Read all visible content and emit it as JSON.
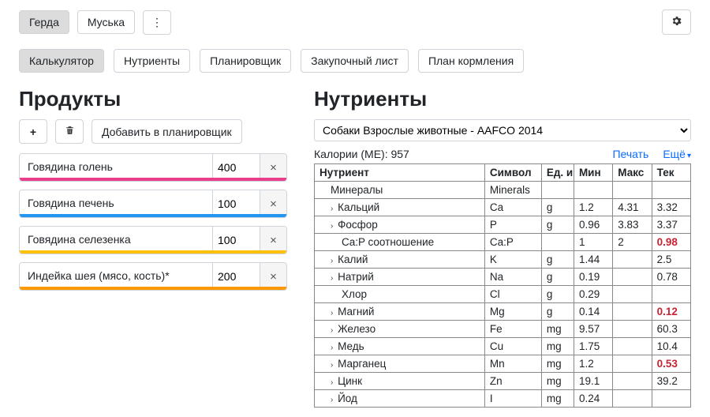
{
  "pets": [
    "Герда",
    "Муська"
  ],
  "activePetIndex": 0,
  "tabs": [
    "Калькулятор",
    "Нутриенты",
    "Планировщик",
    "Закупочный лист",
    "План кормления"
  ],
  "activeTabIndex": 0,
  "leftTitle": "Продукты",
  "rightTitle": "Нутриенты",
  "plannerButton": "Добавить в планировщик",
  "products": [
    {
      "name": "Говядина голень",
      "qty": "400",
      "color": "pink"
    },
    {
      "name": "Говядина печень",
      "qty": "100",
      "color": "blue"
    },
    {
      "name": "Говядина селезенка",
      "qty": "100",
      "color": "yellow"
    },
    {
      "name": "Индейка шея (мясо, кость)*",
      "qty": "200",
      "color": "orange"
    }
  ],
  "profileSelect": "Собаки Взрослые животные - AAFCO 2014",
  "caloriesLabel": "Калории (ME): 957",
  "printLabel": "Печать",
  "moreLabel": "Ещё",
  "tableHeaders": {
    "nutrient": "Нутриент",
    "symbol": "Символ",
    "unit": "Ед. и",
    "min": "Мин",
    "max": "Макс",
    "cur": "Тек"
  },
  "rows": [
    {
      "indent": 1,
      "expandable": false,
      "name": "Минералы",
      "symbol": "Minerals",
      "unit": "",
      "min": "",
      "max": "",
      "cur": "",
      "out": false
    },
    {
      "indent": 1,
      "expandable": true,
      "name": "Кальций",
      "symbol": "Ca",
      "unit": "g",
      "min": "1.2",
      "max": "4.31",
      "cur": "3.32",
      "out": false
    },
    {
      "indent": 1,
      "expandable": true,
      "name": "Фосфор",
      "symbol": "P",
      "unit": "g",
      "min": "0.96",
      "max": "3.83",
      "cur": "3.37",
      "out": false
    },
    {
      "indent": 2,
      "expandable": false,
      "name": "Ca:P соотношение",
      "symbol": "Ca:P",
      "unit": "",
      "min": "1",
      "max": "2",
      "cur": "0.98",
      "out": true
    },
    {
      "indent": 1,
      "expandable": true,
      "name": "Калий",
      "symbol": "K",
      "unit": "g",
      "min": "1.44",
      "max": "",
      "cur": "2.5",
      "out": false
    },
    {
      "indent": 1,
      "expandable": true,
      "name": "Натрий",
      "symbol": "Na",
      "unit": "g",
      "min": "0.19",
      "max": "",
      "cur": "0.78",
      "out": false
    },
    {
      "indent": 2,
      "expandable": false,
      "name": "Хлор",
      "symbol": "Cl",
      "unit": "g",
      "min": "0.29",
      "max": "",
      "cur": "",
      "out": false
    },
    {
      "indent": 1,
      "expandable": true,
      "name": "Магний",
      "symbol": "Mg",
      "unit": "g",
      "min": "0.14",
      "max": "",
      "cur": "0.12",
      "out": true
    },
    {
      "indent": 1,
      "expandable": true,
      "name": "Железо",
      "symbol": "Fe",
      "unit": "mg",
      "min": "9.57",
      "max": "",
      "cur": "60.3",
      "out": false
    },
    {
      "indent": 1,
      "expandable": true,
      "name": "Медь",
      "symbol": "Cu",
      "unit": "mg",
      "min": "1.75",
      "max": "",
      "cur": "10.4",
      "out": false
    },
    {
      "indent": 1,
      "expandable": true,
      "name": "Марганец",
      "symbol": "Mn",
      "unit": "mg",
      "min": "1.2",
      "max": "",
      "cur": "0.53",
      "out": true
    },
    {
      "indent": 1,
      "expandable": true,
      "name": "Цинк",
      "symbol": "Zn",
      "unit": "mg",
      "min": "19.1",
      "max": "",
      "cur": "39.2",
      "out": false
    },
    {
      "indent": 1,
      "expandable": true,
      "name": "Йод",
      "symbol": "I",
      "unit": "mg",
      "min": "0.24",
      "max": "",
      "cur": "",
      "out": false
    }
  ]
}
